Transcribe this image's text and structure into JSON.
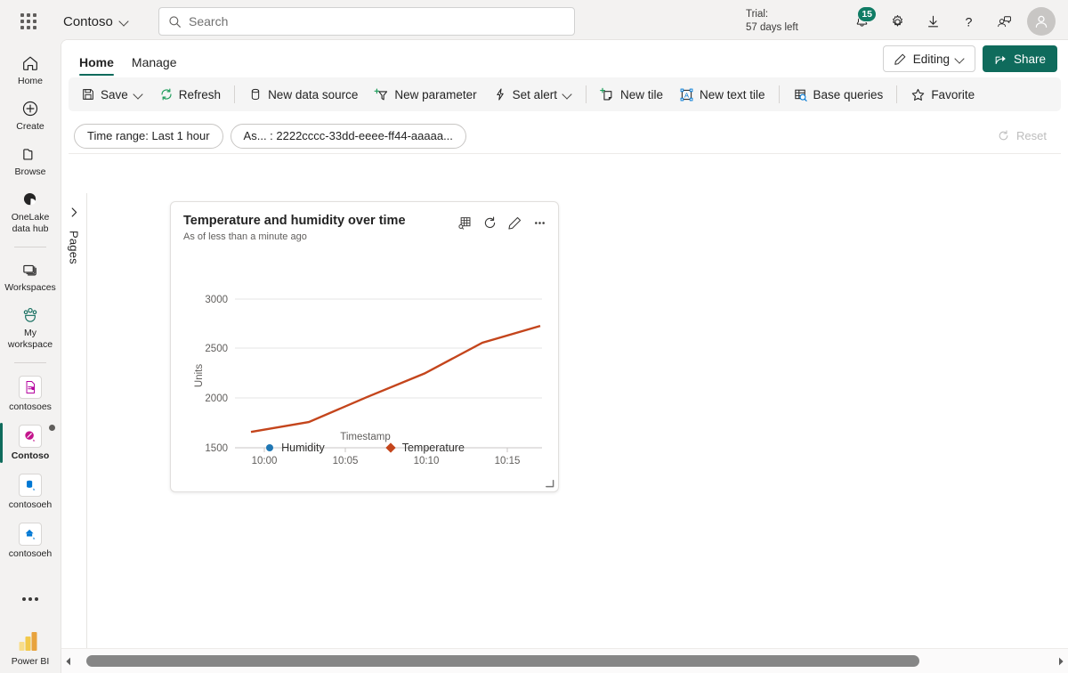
{
  "topbar": {
    "waffle_name": "app-launcher",
    "brand": "Contoso",
    "search_placeholder": "Search",
    "trial_line1": "Trial:",
    "trial_line2": "57 days left",
    "notification_count": "15",
    "icons": [
      "notifications-icon",
      "settings-gear-icon",
      "download-icon",
      "help-icon",
      "feedback-icon",
      "account-avatar"
    ]
  },
  "rail": {
    "items": [
      {
        "label": "Home",
        "icon": "home-icon",
        "selected": false
      },
      {
        "label": "Create",
        "icon": "create-plus-icon",
        "selected": false
      },
      {
        "label": "Browse",
        "icon": "browse-folder-icon",
        "selected": false
      },
      {
        "label": "OneLake data hub",
        "icon": "onelake-icon",
        "selected": false
      },
      {
        "label": "Workspaces",
        "icon": "workspaces-icon",
        "selected": false
      },
      {
        "label": "My workspace",
        "icon": "my-workspace-icon",
        "selected": false
      },
      {
        "label": "contosoes",
        "icon": "workspace-item-icon",
        "selected": false
      },
      {
        "label": "Contoso",
        "icon": "workspace-item-icon",
        "selected": true
      },
      {
        "label": "contosoeh",
        "icon": "workspace-item-icon",
        "selected": false
      },
      {
        "label": "contosoeh",
        "icon": "workspace-item-icon",
        "selected": false
      }
    ],
    "more_label": "more-options",
    "product": "Power BI"
  },
  "tabs": {
    "items": [
      {
        "label": "Home",
        "active": true
      },
      {
        "label": "Manage",
        "active": false
      }
    ],
    "editing_label": "Editing",
    "share_label": "Share"
  },
  "ribbon": {
    "groups": [
      [
        {
          "label": "Save",
          "icon": "save-icon",
          "caret": true
        },
        {
          "label": "Refresh",
          "icon": "refresh-icon",
          "caret": false
        }
      ],
      [
        {
          "label": "New data source",
          "icon": "database-icon",
          "caret": false
        },
        {
          "label": "New parameter",
          "icon": "new-parameter-icon",
          "caret": false
        },
        {
          "label": "Set alert",
          "icon": "alert-bolt-icon",
          "caret": true
        }
      ],
      [
        {
          "label": "New tile",
          "icon": "new-tile-icon",
          "caret": false
        },
        {
          "label": "New text tile",
          "icon": "new-text-tile-icon",
          "caret": false
        }
      ],
      [
        {
          "label": "Base queries",
          "icon": "base-queries-icon",
          "caret": false
        }
      ],
      [
        {
          "label": "Favorite",
          "icon": "star-icon",
          "caret": false
        }
      ]
    ]
  },
  "filters": {
    "pills": [
      "Time range: Last 1 hour",
      "As... : 2222cccc-33dd-eeee-ff44-aaaaa..."
    ],
    "reset_label": "Reset",
    "reset_icon": "reset-circular-arrow-icon",
    "reset_disabled": true
  },
  "pages_panel": {
    "label": "Pages",
    "expand_icon": "chevron-right-icon"
  },
  "tile": {
    "title": "Temperature and humidity over time",
    "subtitle": "As of less than a minute ago",
    "actions": [
      "show-data-table-icon",
      "refresh-icon",
      "edit-pencil-icon",
      "more-options-icon"
    ],
    "resize_handle": "resize-handle"
  },
  "chart_data": {
    "type": "line",
    "title": "Temperature and humidity over time",
    "xlabel": "Timestamp",
    "ylabel": "Units",
    "xticks": [
      "10:00",
      "10:05",
      "10:10",
      "10:15"
    ],
    "yticks": [
      "1500",
      "2000",
      "2500",
      "3000"
    ],
    "ylim": [
      1500,
      3000
    ],
    "grid": true,
    "legend_position": "bottom",
    "series": [
      {
        "name": "Humidity",
        "color": "#1f77b4",
        "marker": "circle",
        "x": [],
        "values": []
      },
      {
        "name": "Temperature",
        "color": "#c4451c",
        "marker": "diamond",
        "x": [
          "09:58",
          "10:00",
          "10:05",
          "10:10",
          "10:15",
          "10:17"
        ],
        "values": [
          1660,
          1760,
          2010,
          2250,
          2560,
          2730
        ]
      }
    ]
  },
  "scrollbar": {
    "left_arrow": "scroll-left-arrow",
    "right_arrow": "scroll-right-arrow",
    "thumb": "horizontal-scroll-thumb"
  },
  "colors": {
    "accent": "#0f6b5c",
    "badge": "#107c65",
    "temperature": "#c4451c",
    "humidity": "#1f77b4"
  }
}
